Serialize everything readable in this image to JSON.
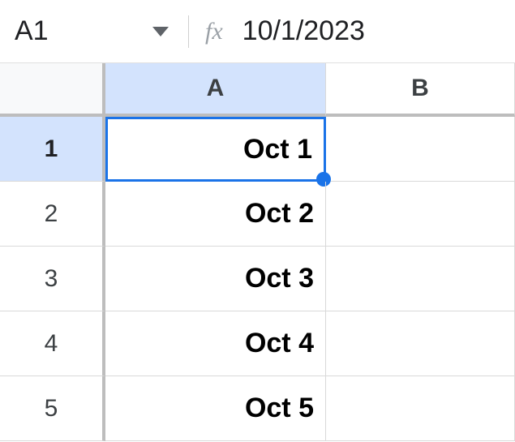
{
  "selection": {
    "name_box": "A1",
    "formula": "10/1/2023"
  },
  "columns": [
    "A",
    "B"
  ],
  "rows": [
    "1",
    "2",
    "3",
    "4",
    "5"
  ],
  "cells": {
    "A1": "Oct 1",
    "A2": "Oct 2",
    "A3": "Oct 3",
    "A4": "Oct 4",
    "A5": "Oct 5"
  },
  "selected_cell": "A1",
  "selected_col": "A",
  "selected_row": "1"
}
